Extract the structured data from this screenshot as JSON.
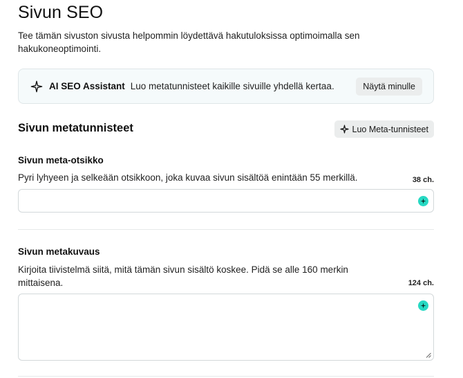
{
  "page": {
    "title": "Sivun SEO",
    "description": "Tee tämän sivuston sivusta helpommin löydettävä hakutuloksissa optimoimalla sen hakukoneoptimointi."
  },
  "assistant": {
    "name": "AI SEO Assistant",
    "text": "Luo metatunnisteet kaikille sivuille yhdellä kertaa.",
    "button_label": "Näytä minulle"
  },
  "meta_section": {
    "title": "Sivun metatunnisteet",
    "generate_button_label": "Luo Meta-tunnisteet"
  },
  "meta_title": {
    "label": "Sivun meta-otsikko",
    "hint": "Pyri lyhyeen ja selkeään otsikkoon, joka kuvaa sivun sisältöä enintään 55 merkillä.",
    "counter": "38 ch.",
    "value": ""
  },
  "meta_description": {
    "label": "Sivun metakuvaus",
    "hint": "Kirjoita tiivistelmä siitä, mitä tämän sivun sisältö koskee. Pidä se alle 160 merkin mittaisena.",
    "counter": "124 ch.",
    "value": ""
  },
  "icons": {
    "assistant": "sparkle-icon",
    "generate": "sparkle-icon",
    "ai_fill": "ai-plus-icon",
    "resize": "resize-handle-icon"
  },
  "colors": {
    "ai_accent": "#27d9c3",
    "assistant_bg": "#f5fafb"
  }
}
